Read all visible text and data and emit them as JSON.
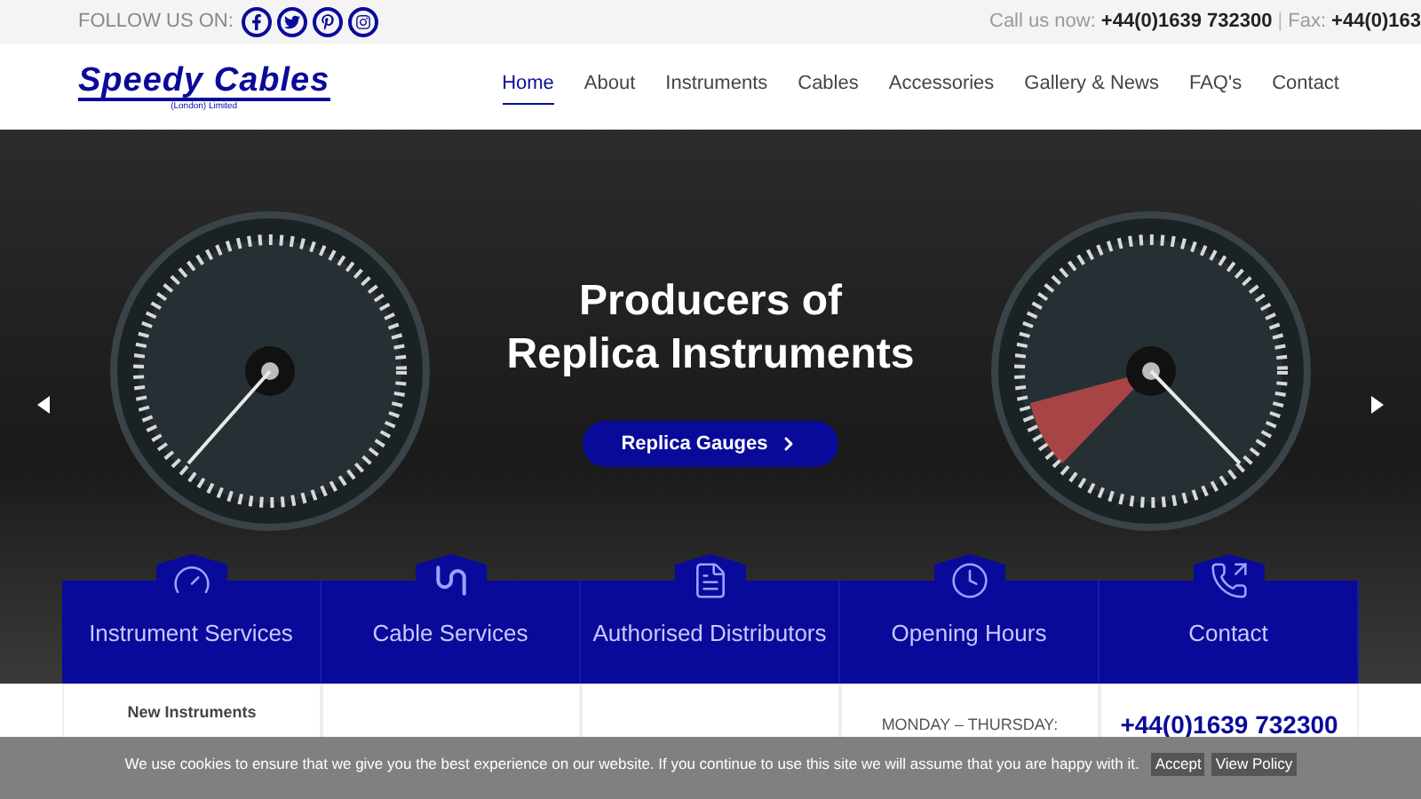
{
  "top_bar": {
    "follow_label": "FOLLOW US ON:",
    "social": [
      {
        "kind": "facebook"
      },
      {
        "kind": "twitter"
      },
      {
        "kind": "pinterest"
      },
      {
        "kind": "instagram"
      }
    ],
    "call_label": "Call us now:",
    "phone": "+44(0)1639 732300",
    "separator": "|",
    "fax_label": "Fax:",
    "fax": "+44(0)163"
  },
  "header": {
    "logo_name": "Speedy Cables",
    "logo_sub": "(London) Limited",
    "nav": [
      {
        "label": "Home",
        "selected": true
      },
      {
        "label": "About",
        "selected": false
      },
      {
        "label": "Instruments",
        "selected": false
      },
      {
        "label": "Cables",
        "selected": false
      },
      {
        "label": "Accessories",
        "selected": false
      },
      {
        "label": "Gallery & News",
        "selected": false
      },
      {
        "label": "FAQ's",
        "selected": false
      },
      {
        "label": "Contact",
        "selected": false
      }
    ]
  },
  "hero": {
    "title": [
      "Producers of",
      "Replica Instruments"
    ],
    "button": "Replica Gauges"
  },
  "cards": [
    {
      "title": "Instrument Services",
      "body": "New Instruments",
      "kind": "heading"
    },
    {
      "title": "Cable Services"
    },
    {
      "title": "Authorised Distributors"
    },
    {
      "title": "Opening Hours",
      "body": "MONDAY – THURSDAY:",
      "kind": "caps"
    },
    {
      "title": "Contact",
      "body": "+44(0)1639 732300",
      "kind": "phone"
    }
  ],
  "cookie_bar": {
    "text": "We use cookies to ensure that we give you the best experience on our website. If you continue to use this site we will assume that you are happy with it.",
    "buttons": [
      "Accept",
      "View Policy"
    ]
  }
}
